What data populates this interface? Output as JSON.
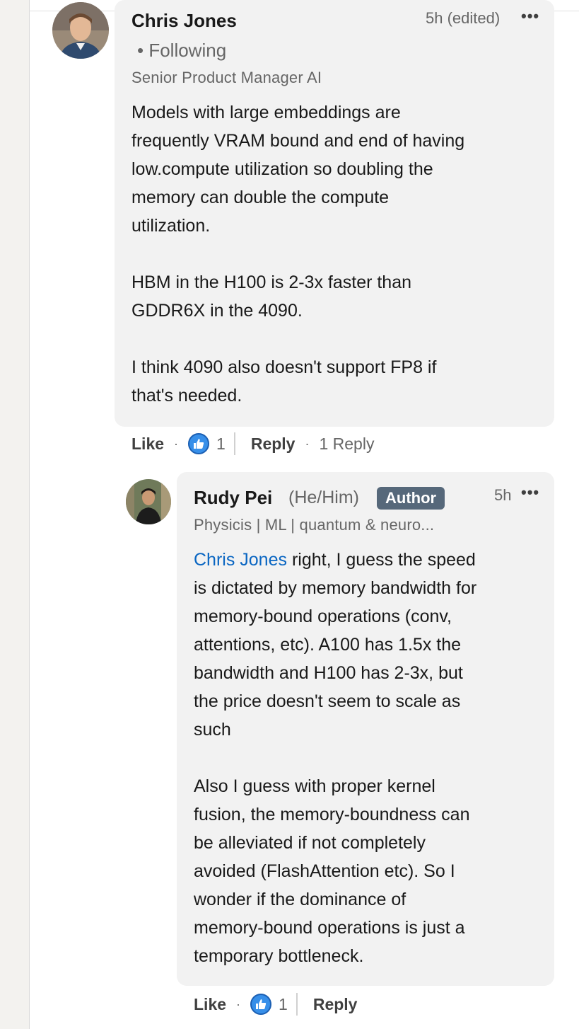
{
  "comment": {
    "author_name": "Chris Jones",
    "following_text": "• Following",
    "headline": "Senior Product Manager AI",
    "time": "5h (edited)",
    "more_icon": "•••",
    "body": "Models with large embeddings are\nfrequently VRAM bound and end of having\nlow.compute utilization so doubling the\nmemory can double the compute\nutilization.\n\nHBM in the H100 is 2-3x faster than\nGDDR6X in the 4090.\n\nI think 4090 also doesn't support FP8 if\nthat's needed.",
    "like_label": "Like",
    "dot": "·",
    "like_count": "1",
    "reply_label": "Reply",
    "reply_count_text": "1 Reply"
  },
  "reply": {
    "author_name": "Rudy Pei",
    "pronouns": "(He/Him)",
    "badge": "Author",
    "headline": "Physicis | ML | quantum & neuro...",
    "time": "5h",
    "more_icon": "•••",
    "mention": "Chris Jones",
    "body_after_mention": " right, I guess the speed\nis dictated by memory bandwidth for\nmemory-bound operations (conv,\nattentions, etc). A100 has 1.5x the\nbandwidth and H100 has 2-3x, but\nthe price doesn't seem to scale as\nsuch\n\nAlso I guess with proper kernel\nfusion, the memory-boundness can\nbe alleviated if not completely\navoided (FlashAttention etc). So I\nwonder if the dominance of\nmemory-bound operations is just a\ntemporary bottleneck.",
    "like_label": "Like",
    "dot": "·",
    "like_count": "1",
    "reply_label": "Reply"
  },
  "icons": {
    "like": "thumbs-up-icon",
    "more": "more-options-icon"
  },
  "colors": {
    "accent": "#0a66c2",
    "like_blue": "#378fe9",
    "badge_bg": "#56687a",
    "bubble_bg": "#f2f2f2"
  }
}
